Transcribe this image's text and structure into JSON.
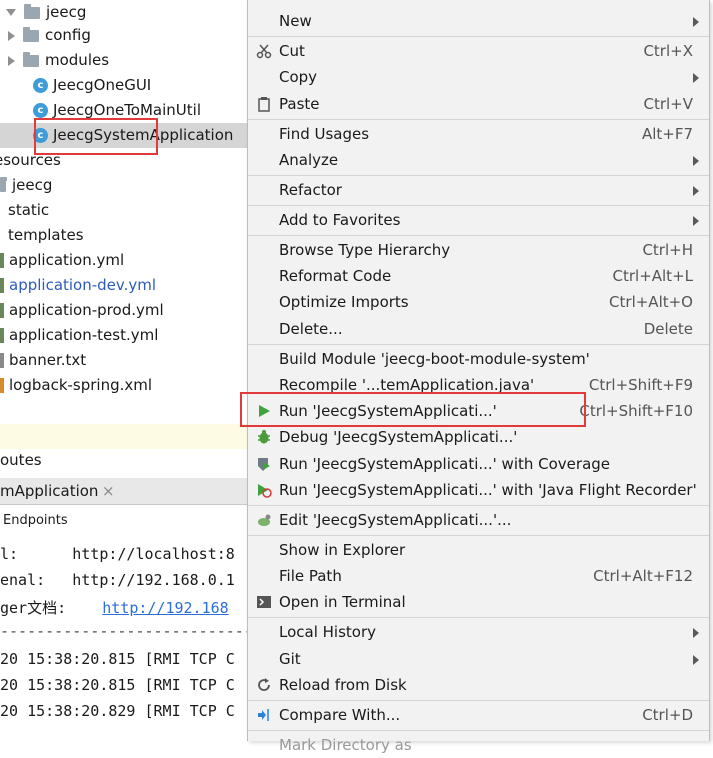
{
  "tree": {
    "items": [
      {
        "label": "jeecg"
      },
      {
        "label": "config"
      },
      {
        "label": "modules"
      },
      {
        "label": "JeecgOneGUI"
      },
      {
        "label": "JeecgOneToMainUtil"
      },
      {
        "label": "JeecgSystemApplication"
      },
      {
        "label": "esources"
      },
      {
        "label": "jeecg"
      },
      {
        "label": "static"
      },
      {
        "label": "templates"
      },
      {
        "label": "application.yml"
      },
      {
        "label": "application-dev.yml"
      },
      {
        "label": "application-prod.yml"
      },
      {
        "label": "application-test.yml"
      },
      {
        "label": "banner.txt"
      },
      {
        "label": "logback-spring.xml"
      },
      {
        "label": "outes"
      }
    ]
  },
  "run_panel": {
    "tab_label": "mApplication",
    "endpoints_label": "Endpoints",
    "lines": [
      {
        "prefix": "l:",
        "value": "http://localhost:8"
      },
      {
        "prefix": "enal:",
        "value": "http://192.168.0.1"
      },
      {
        "prefix": "ger文档:",
        "value": "http://192.168"
      },
      {
        "prefix": "",
        "value": "--------------------------------"
      },
      {
        "prefix": "20 15:38:20.815 [RMI TCP C",
        "value": ""
      },
      {
        "prefix": "20 15:38:20.815 [RMI TCP C",
        "value": ""
      },
      {
        "prefix": "20 15:38:20.829 [RMI TCP C",
        "value": ""
      }
    ]
  },
  "menu": {
    "new": "New",
    "cut": "Cut",
    "cut_sc": "Ctrl+X",
    "copy": "Copy",
    "paste": "Paste",
    "paste_sc": "Ctrl+V",
    "find_usages": "Find Usages",
    "find_usages_sc": "Alt+F7",
    "analyze": "Analyze",
    "refactor": "Refactor",
    "add_favorites": "Add to Favorites",
    "browse_hierarchy": "Browse Type Hierarchy",
    "browse_hierarchy_sc": "Ctrl+H",
    "reformat": "Reformat Code",
    "reformat_sc": "Ctrl+Alt+L",
    "optimize": "Optimize Imports",
    "optimize_sc": "Ctrl+Alt+O",
    "delete": "Delete...",
    "delete_sc": "Delete",
    "build_module": "Build Module 'jeecg-boot-module-system'",
    "recompile": "Recompile '...temApplication.java'",
    "recompile_sc": "Ctrl+Shift+F9",
    "run": "Run 'JeecgSystemApplicati...'",
    "run_sc": "Ctrl+Shift+F10",
    "debug": "Debug 'JeecgSystemApplicati...'",
    "run_coverage": "Run 'JeecgSystemApplicati...' with Coverage",
    "run_jfr": "Run 'JeecgSystemApplicati...' with 'Java Flight Recorder'",
    "edit": "Edit 'JeecgSystemApplicati...'...",
    "show_explorer": "Show in Explorer",
    "file_path": "File Path",
    "file_path_sc": "Ctrl+Alt+F12",
    "open_terminal": "Open in Terminal",
    "local_history": "Local History",
    "git": "Git",
    "reload": "Reload from Disk",
    "compare": "Compare With...",
    "compare_sc": "Ctrl+D",
    "mark_directory": "Mark Directory as"
  },
  "colors": {
    "run_green": "#3ea33e",
    "highlight_red": "#e03a3a",
    "link_blue": "#2c6ed7"
  }
}
